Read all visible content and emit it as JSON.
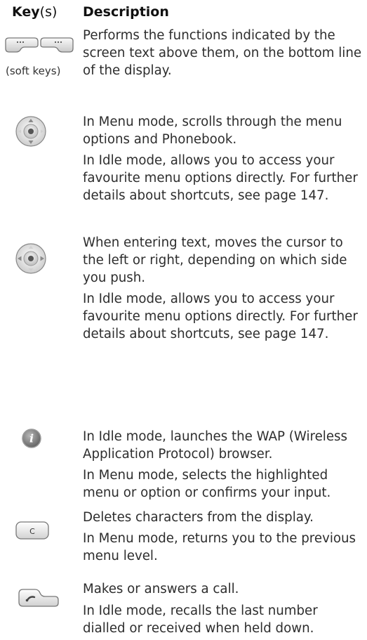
{
  "header": {
    "key_word": "Key",
    "key_suffix": "(s)",
    "description": "Description"
  },
  "rows": [
    {
      "icon": "soft-keys-icon",
      "caption": "(soft keys)",
      "paragraphs": [
        "Performs the functions indicated by the screen text above them, on the bottom line of the display."
      ]
    },
    {
      "icon": "navigation-key-up-down-icon",
      "paragraphs": [
        "In Menu mode, scrolls through the menu options and Phonebook.",
        "In Idle mode, allows you to access your favourite menu options directly. For further details about shortcuts, see page 147."
      ]
    },
    {
      "icon": "navigation-key-left-right-icon",
      "paragraphs": [
        "When entering text, moves the cursor to the left or right, depending on which side you push.",
        "In Idle mode, allows you to access your favourite menu options directly. For further details about shortcuts, see page 147."
      ]
    },
    {
      "icon": "wap-info-key-icon",
      "paragraphs": [
        "In Idle mode, launches the WAP (Wireless Application Protocol) browser.",
        "In Menu mode, selects the highlighted menu or option or confirms your input."
      ]
    },
    {
      "icon": "clear-key-icon",
      "icon_text": "C",
      "paragraphs": [
        "Deletes characters from the display.",
        "In Menu mode, returns you to the previous menu level."
      ]
    },
    {
      "icon": "send-call-key-icon",
      "paragraphs": [
        "Makes or answers a call.",
        "In Idle mode, recalls the last number dialled or received when held down."
      ]
    }
  ]
}
